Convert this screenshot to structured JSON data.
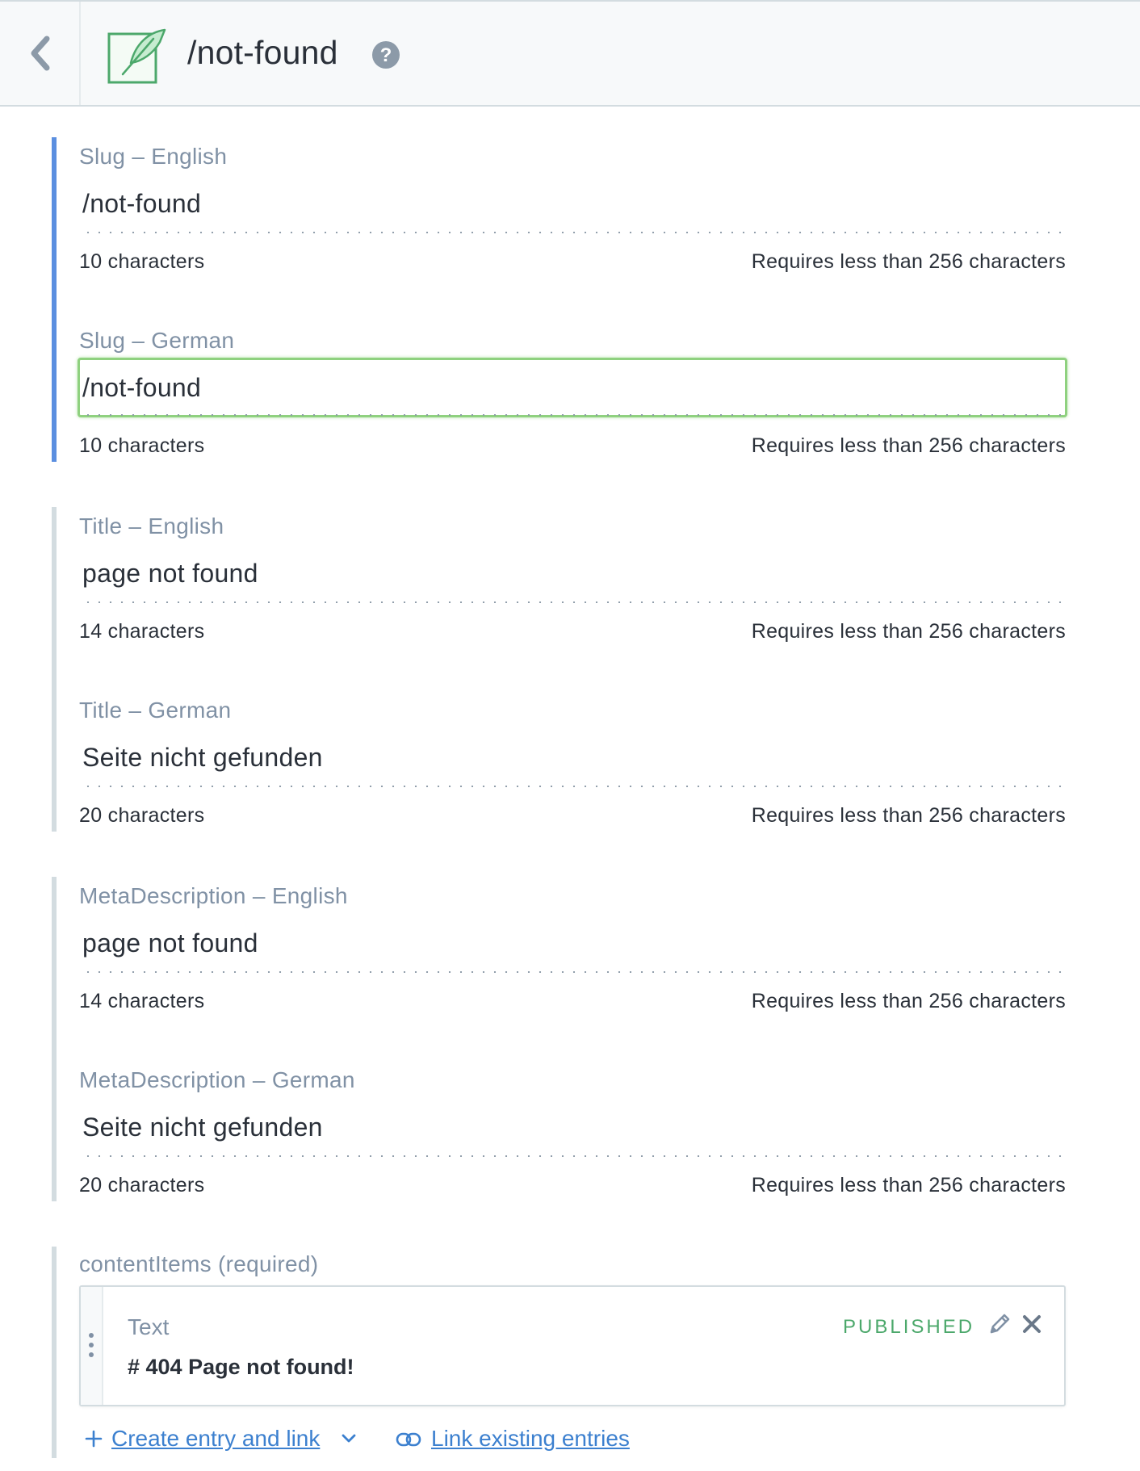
{
  "header": {
    "title": "/not-found",
    "back_icon": "chevron-left-icon",
    "entry_icon": "feather-icon",
    "help_icon": "question-circle-icon"
  },
  "fields": [
    {
      "label": "Slug – English",
      "value": "/not-found",
      "count": "10 characters",
      "limit": "Requires less than 256 characters"
    },
    {
      "label": "Slug – German",
      "value": "/not-found",
      "count": "10 characters",
      "limit": "Requires less than 256 characters"
    },
    {
      "label": "Title – English",
      "value": "page not found",
      "count": "14 characters",
      "limit": "Requires less than 256 characters"
    },
    {
      "label": "Title – German",
      "value": "Seite nicht gefunden",
      "count": "20 characters",
      "limit": "Requires less than 256 characters"
    },
    {
      "label": "MetaDescription – English",
      "value": "page not found",
      "count": "14 characters",
      "limit": "Requires less than 256 characters"
    },
    {
      "label": "MetaDescription – German",
      "value": "Seite nicht gefunden",
      "count": "20 characters",
      "limit": "Requires less than 256 characters"
    }
  ],
  "content_items": {
    "label": "contentItems (required)",
    "card": {
      "type": "Text",
      "status": "PUBLISHED",
      "body": "# 404 Page not found!"
    },
    "create_link": "Create entry and link",
    "link_existing": "Link existing entries"
  },
  "colors": {
    "active_bar": "#5b8fe0",
    "focus_border": "#8fd17f",
    "published": "#4ca86b",
    "link": "#3c80cf"
  }
}
